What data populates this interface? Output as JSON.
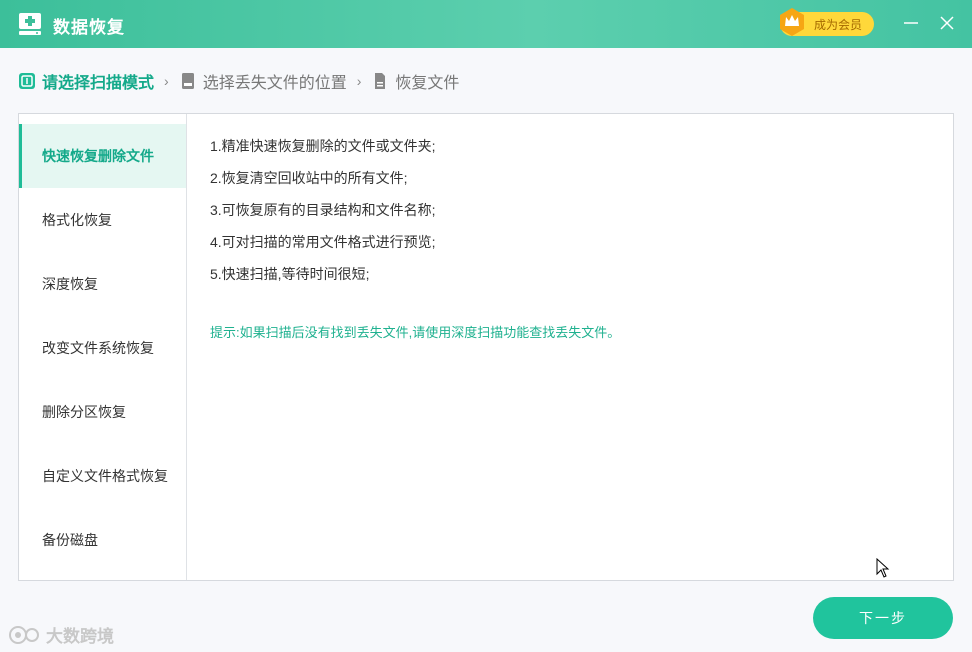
{
  "titlebar": {
    "app_title": "数据恢复",
    "vip_label": "成为会员",
    "logo_icon": "plus-disk-icon",
    "minimize_icon": "minimize-icon",
    "close_icon": "close-icon"
  },
  "breadcrumb": {
    "steps": [
      {
        "label": "请选择扫描模式",
        "icon": "scan-icon",
        "active": true
      },
      {
        "label": "选择丢失文件的位置",
        "icon": "drive-icon",
        "active": false
      },
      {
        "label": "恢复文件",
        "icon": "file-icon",
        "active": false
      }
    ],
    "separator": "›"
  },
  "sidebar": {
    "items": [
      {
        "label": "快速恢复删除文件",
        "active": true
      },
      {
        "label": "格式化恢复",
        "active": false
      },
      {
        "label": "深度恢复",
        "active": false
      },
      {
        "label": "改变文件系统恢复",
        "active": false
      },
      {
        "label": "删除分区恢复",
        "active": false
      },
      {
        "label": "自定义文件格式恢复",
        "active": false
      },
      {
        "label": "备份磁盘",
        "active": false
      }
    ]
  },
  "content": {
    "lines": [
      "1.精准快速恢复删除的文件或文件夹;",
      "2.恢复清空回收站中的所有文件;",
      "3.可恢复原有的目录结构和文件名称;",
      "4.可对扫描的常用文件格式进行预览;",
      "5.快速扫描,等待时间很短;"
    ],
    "tip": "提示:如果扫描后没有找到丢失文件,请使用深度扫描功能查找丢失文件。"
  },
  "footer": {
    "next_label": "下一步",
    "watermark": "大数跨境"
  },
  "colors": {
    "accent": "#20c49d",
    "active_text": "#14a98a",
    "vip": "#ffd83a"
  }
}
